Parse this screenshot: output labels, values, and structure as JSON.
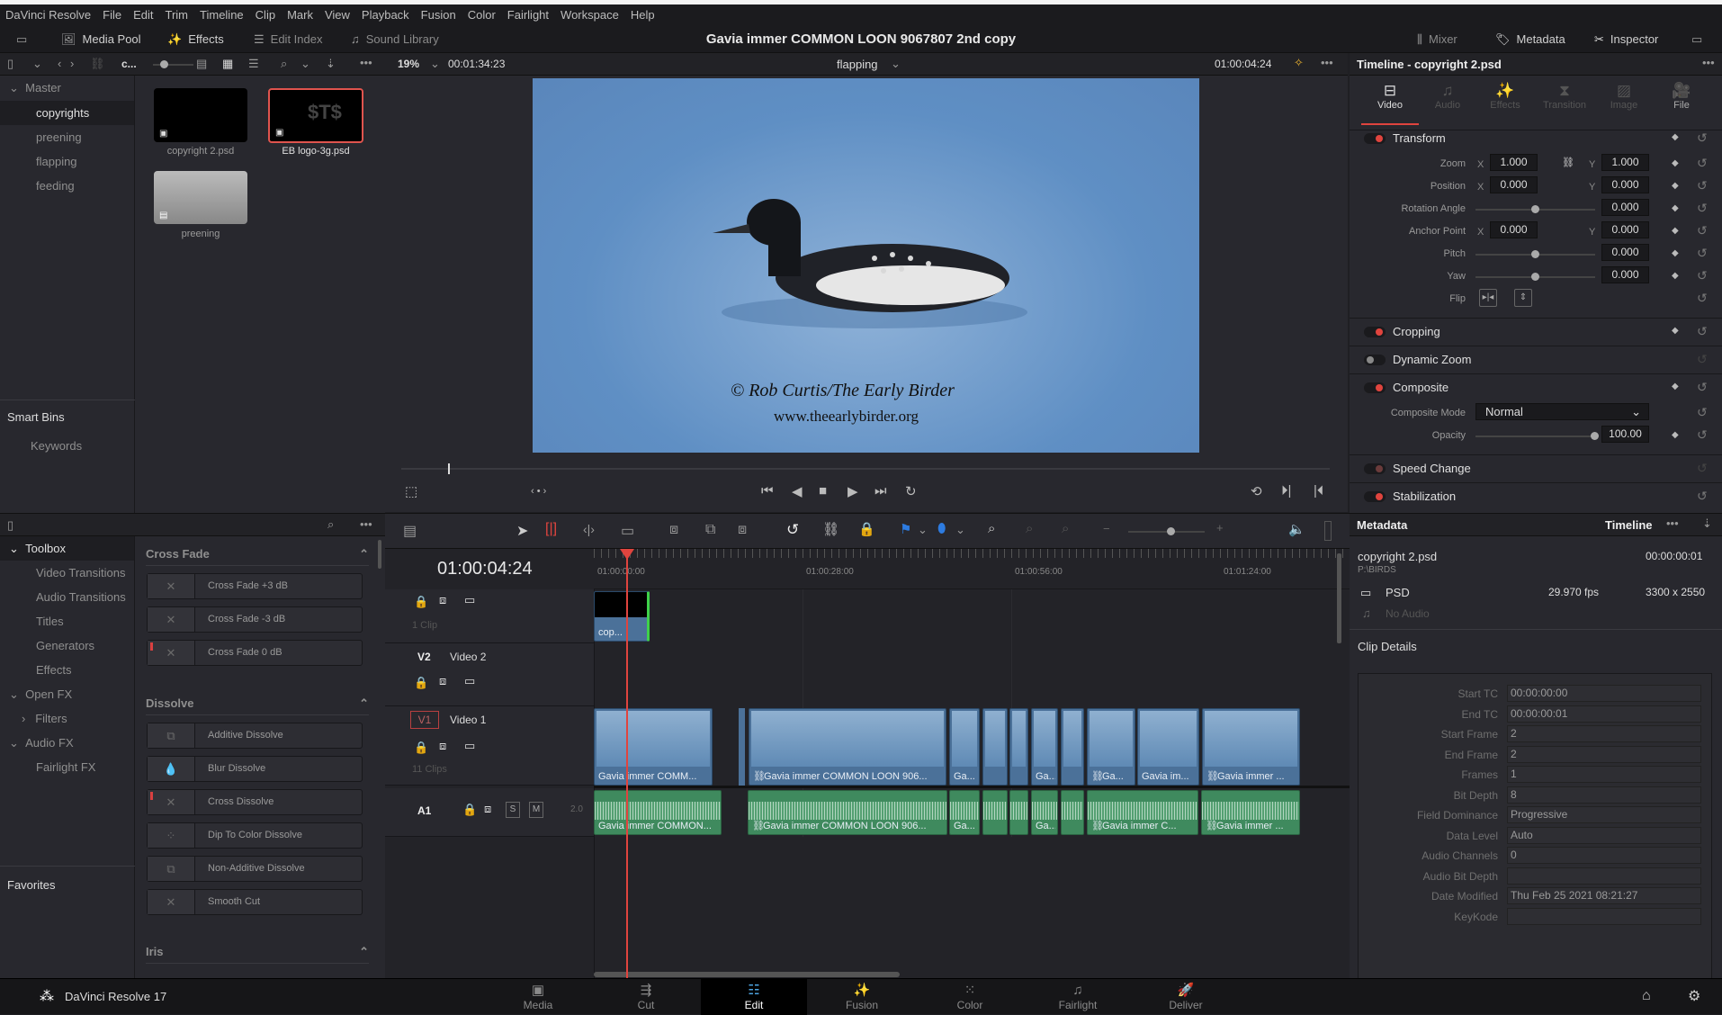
{
  "menu": [
    "DaVinci Resolve",
    "File",
    "Edit",
    "Trim",
    "Timeline",
    "Clip",
    "Mark",
    "View",
    "Playback",
    "Fusion",
    "Color",
    "Fairlight",
    "Workspace",
    "Help"
  ],
  "toolbar": {
    "media_pool": "Media Pool",
    "effects": "Effects",
    "edit_index": "Edit Index",
    "sound_library": "Sound Library",
    "mixer": "Mixer",
    "metadata": "Metadata",
    "inspector": "Inspector"
  },
  "window_title": "Gavia immer  COMMON LOON 9067807 2nd copy",
  "media_pool": {
    "bin_path": "c...",
    "master": "Master",
    "bins": [
      "copyrights",
      "preening",
      "flapping",
      "feeding"
    ],
    "selected_bin": "copyrights",
    "smart_bins": "Smart Bins",
    "keywords": "Keywords",
    "clips": [
      "copyright 2.psd",
      "EB logo-3g.psd",
      "preening"
    ]
  },
  "effects": {
    "toolbox": "Toolbox",
    "tree": [
      "Video Transitions",
      "Audio Transitions",
      "Titles",
      "Generators",
      "Effects"
    ],
    "open_fx": "Open FX",
    "filters": "Filters",
    "audio_fx": "Audio FX",
    "fairlight_fx": "Fairlight FX",
    "favorites": "Favorites",
    "sections": {
      "cross_fade": {
        "title": "Cross Fade",
        "items": [
          "Cross Fade +3 dB",
          "Cross Fade -3 dB",
          "Cross Fade 0 dB"
        ]
      },
      "dissolve": {
        "title": "Dissolve",
        "items": [
          "Additive Dissolve",
          "Blur Dissolve",
          "Cross Dissolve",
          "Dip To Color Dissolve",
          "Non-Additive Dissolve",
          "Smooth Cut"
        ]
      },
      "iris": {
        "title": "Iris"
      }
    }
  },
  "viewer": {
    "zoom": "19%",
    "source_tc": "00:01:34:23",
    "timeline_name": "flapping",
    "record_tc": "01:00:04:24",
    "watermark_line1": "© Rob Curtis/The Early Birder",
    "watermark_line2": "www.theearlybirder.org"
  },
  "timeline": {
    "timecode": "01:00:04:24",
    "ruler": [
      "01:00:00:00",
      "01:00:28:00",
      "01:00:56:00",
      "01:01:24:00"
    ],
    "tracks": {
      "v3": {
        "count": "1 Clip"
      },
      "v2": {
        "id": "V2",
        "name": "Video 2"
      },
      "v1": {
        "id": "V1",
        "name": "Video 1",
        "count": "11 Clips"
      },
      "a1": {
        "id": "A1",
        "solo": "S",
        "mute": "M",
        "channels": "2.0"
      }
    },
    "v3_clip": "cop...",
    "video_clips": [
      "Gavia immer  COMM...",
      "Gavia immer  COMMON LOON 906...",
      "Ga...",
      "",
      "",
      "Ga...",
      "",
      "Ga...",
      "Gavia im...",
      "Gavia immer ..."
    ],
    "audio_clips": [
      "Gavia immer  COMMON...",
      "Gavia immer  COMMON LOON 906...",
      "Ga...",
      "",
      "",
      "Ga...",
      "",
      "Gavia immer  C...",
      "Gavia immer ..."
    ]
  },
  "inspector": {
    "title": "Timeline - copyright 2.psd",
    "tabs": [
      "Video",
      "Audio",
      "Effects",
      "Transition",
      "Image",
      "File"
    ],
    "active_tab": "Video",
    "transform": "Transform",
    "zoom": {
      "label": "Zoom",
      "x": "1.000",
      "y": "1.000"
    },
    "position": {
      "label": "Position",
      "x": "0.000",
      "y": "0.000"
    },
    "rotation": {
      "label": "Rotation Angle",
      "value": "0.000"
    },
    "anchor": {
      "label": "Anchor Point",
      "x": "0.000",
      "y": "0.000"
    },
    "pitch": {
      "label": "Pitch",
      "value": "0.000"
    },
    "yaw": {
      "label": "Yaw",
      "value": "0.000"
    },
    "flip": "Flip",
    "cropping": "Cropping",
    "dynamic_zoom": "Dynamic Zoom",
    "composite": "Composite",
    "composite_mode": {
      "label": "Composite Mode",
      "value": "Normal"
    },
    "opacity": {
      "label": "Opacity",
      "value": "100.00"
    },
    "speed_change": "Speed Change",
    "stabilization": "Stabilization",
    "xlabel": "X",
    "ylabel": "Y"
  },
  "metadata": {
    "title": "Metadata",
    "mode": "Timeline",
    "clip_name": "copyright 2.psd",
    "path": "P:\\BIRDS",
    "duration": "00:00:00:01",
    "format": "PSD",
    "fps": "29.970 fps",
    "resolution": "3300 x 2550",
    "audio": "No Audio",
    "clip_details": "Clip Details",
    "fields": [
      {
        "label": "Start TC",
        "value": "00:00:00:00"
      },
      {
        "label": "End TC",
        "value": "00:00:00:01"
      },
      {
        "label": "Start Frame",
        "value": "2"
      },
      {
        "label": "End Frame",
        "value": "2"
      },
      {
        "label": "Frames",
        "value": "1"
      },
      {
        "label": "Bit Depth",
        "value": "8"
      },
      {
        "label": "Field Dominance",
        "value": "Progressive"
      },
      {
        "label": "Data Level",
        "value": "Auto"
      },
      {
        "label": "Audio Channels",
        "value": "0"
      },
      {
        "label": "Audio Bit Depth",
        "value": ""
      },
      {
        "label": "Date Modified",
        "value": "Thu Feb 25 2021 08:21:27"
      },
      {
        "label": "KeyKode",
        "value": ""
      }
    ]
  },
  "bottom": {
    "app_name": "DaVinci Resolve 17",
    "pages": [
      "Media",
      "Cut",
      "Edit",
      "Fusion",
      "Color",
      "Fairlight",
      "Deliver"
    ],
    "active_page": "Edit"
  },
  "colors": {
    "accent_red": "#e0443e",
    "video_clip": "#4b7199",
    "audio_clip": "#3f8a5e",
    "playhead": "#e0443e"
  }
}
